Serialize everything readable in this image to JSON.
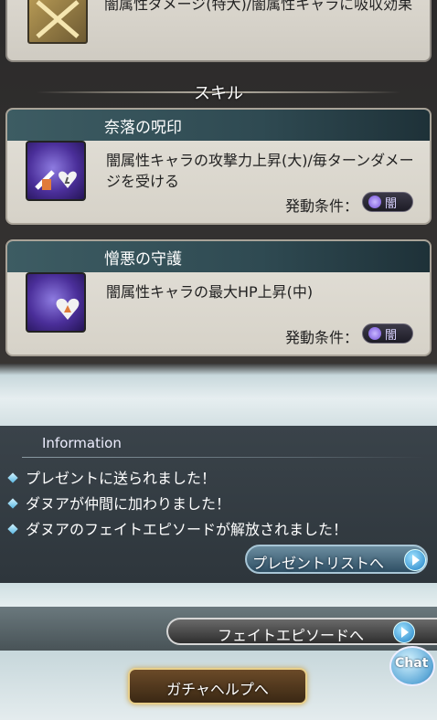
{
  "top_card": {
    "text": "闇属性ダメージ(特大)/闇属性キャラに吸収効果"
  },
  "skills_section": {
    "label": "スキル"
  },
  "skills": [
    {
      "name": "奈落の呪印",
      "description": "闇属性キャラの攻撃力上昇(大)/毎ターンダメージを受ける",
      "condition_label": "発動条件：",
      "element": "闇"
    },
    {
      "name": "憎悪の守護",
      "description": "闇属性キャラの最大HP上昇(中)",
      "condition_label": "発動条件：",
      "element": "闇"
    }
  ],
  "information": {
    "title": "Information",
    "items": [
      "プレゼントに送られました！",
      "ダヌアが仲間に加わりました！",
      "ダヌアのフェイトエピソードが解放されました！"
    ],
    "present_button": "プレゼントリストへ"
  },
  "fate_episode_button": "フェイトエピソードへ",
  "chat_button": "Chat",
  "gacha_help_button": "ガチャヘルプへ",
  "colors": {
    "header_bar": "#2f4a52",
    "panel": "#e3e0d8",
    "info_bg": "#2e363c",
    "accent_blue": "#1f7fc4",
    "gold": "#e8cf8a"
  }
}
